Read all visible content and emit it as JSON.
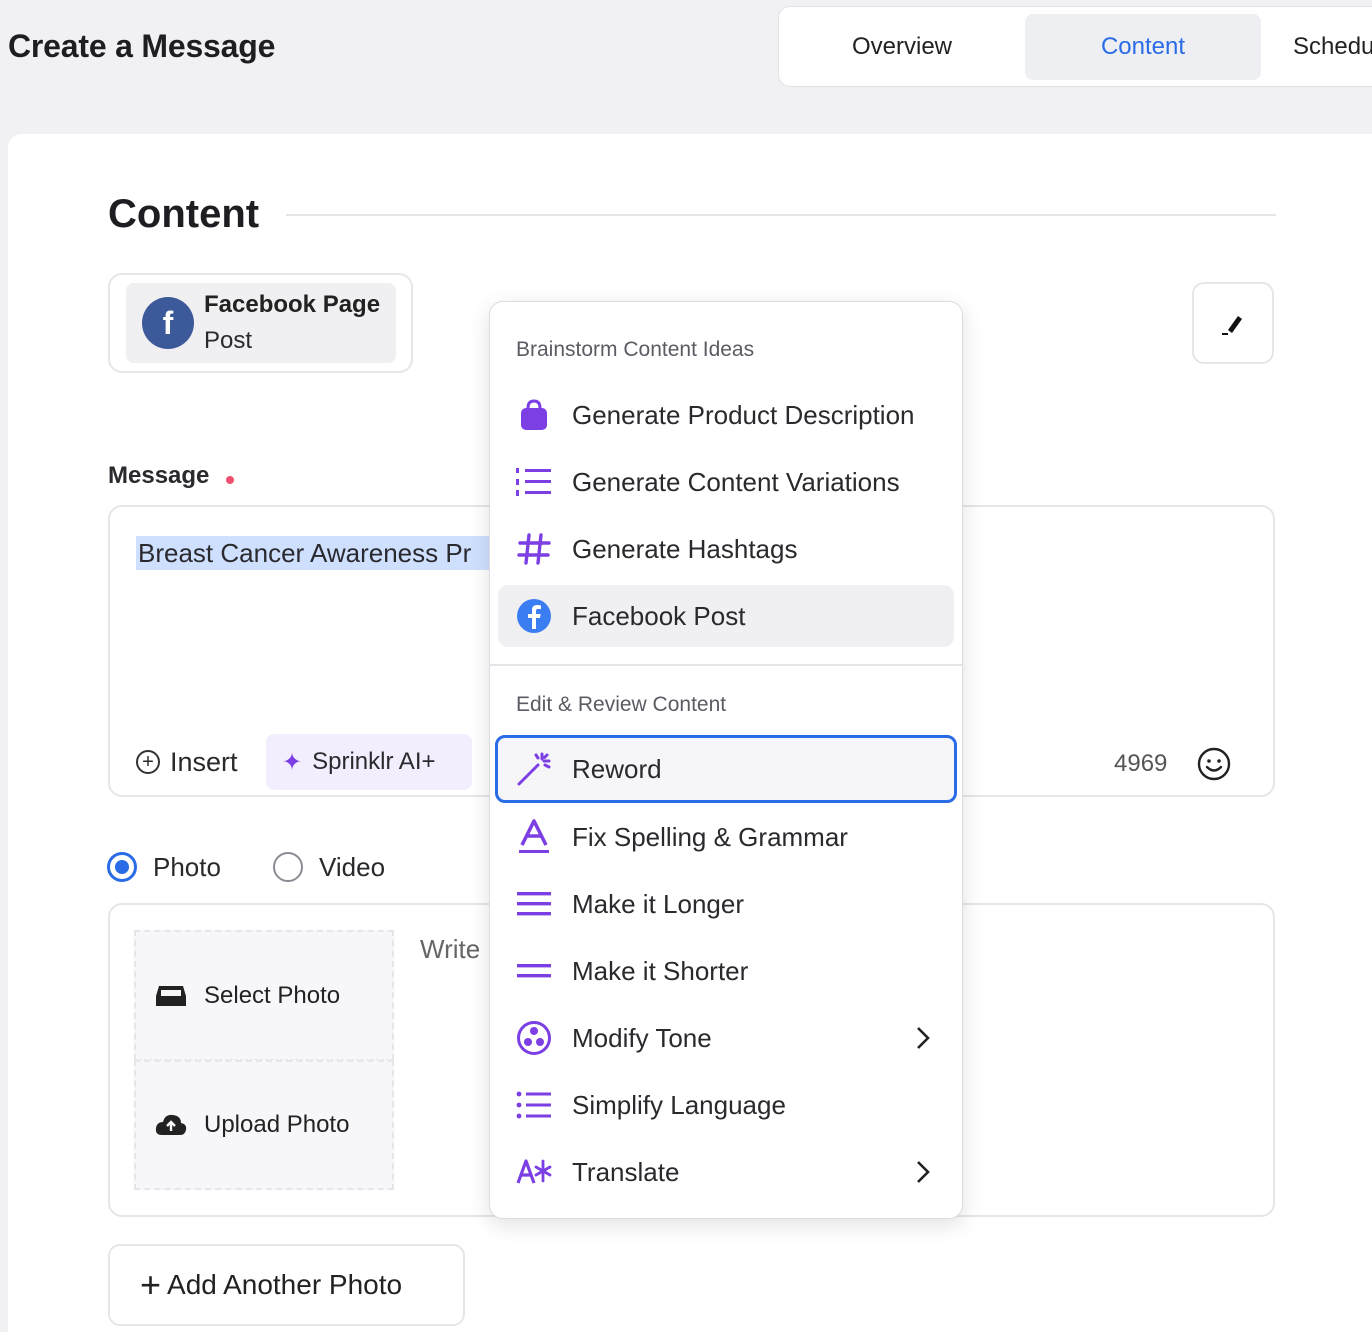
{
  "header": {
    "title": "Create a Message",
    "tabs": [
      {
        "label": "Overview"
      },
      {
        "label": "Content",
        "active": true
      },
      {
        "label": "Schedu"
      }
    ]
  },
  "content": {
    "section_title": "Content",
    "channel": {
      "name_line1": "Facebook Page",
      "name_line2": "Post",
      "icon": "facebook-icon"
    },
    "message_label": "Message",
    "message_text": "Breast Cancer Awareness Pr",
    "insert_label": "Insert",
    "sprinklr_label": "Sprinklr AI+",
    "char_count": "4969",
    "media_options": [
      {
        "label": "Photo",
        "selected": true
      },
      {
        "label": "Video",
        "selected": false
      }
    ],
    "select_photo_label": "Select Photo",
    "upload_photo_label": "Upload Photo",
    "write_text": "Write",
    "add_photo_label": "Add Another Photo"
  },
  "menu": {
    "group1_title": "Brainstorm Content Ideas",
    "group1": [
      {
        "label": "Generate Product Description",
        "icon": "shopping-bag-icon"
      },
      {
        "label": "Generate Content Variations",
        "icon": "numbered-list-icon"
      },
      {
        "label": "Generate Hashtags",
        "icon": "hashtag-icon"
      },
      {
        "label": "Facebook Post",
        "icon": "facebook-icon",
        "hovered": true
      }
    ],
    "group2_title": "Edit & Review Content",
    "group2": [
      {
        "label": "Reword",
        "icon": "magic-wand-icon",
        "focused": true
      },
      {
        "label": "Fix Spelling & Grammar",
        "icon": "spell-check-icon"
      },
      {
        "label": "Make it Longer",
        "icon": "lines-icon"
      },
      {
        "label": "Make it Shorter",
        "icon": "short-lines-icon"
      },
      {
        "label": "Modify Tone",
        "icon": "tone-icon",
        "submenu": true
      },
      {
        "label": "Simplify Language",
        "icon": "list-icon"
      },
      {
        "label": "Translate",
        "icon": "translate-icon",
        "submenu": true
      }
    ]
  },
  "colors": {
    "accent": "#2a6be6",
    "ai_purple": "#7b3fe4",
    "facebook": "#3c5a99",
    "highlight": "#cfe0ff"
  }
}
